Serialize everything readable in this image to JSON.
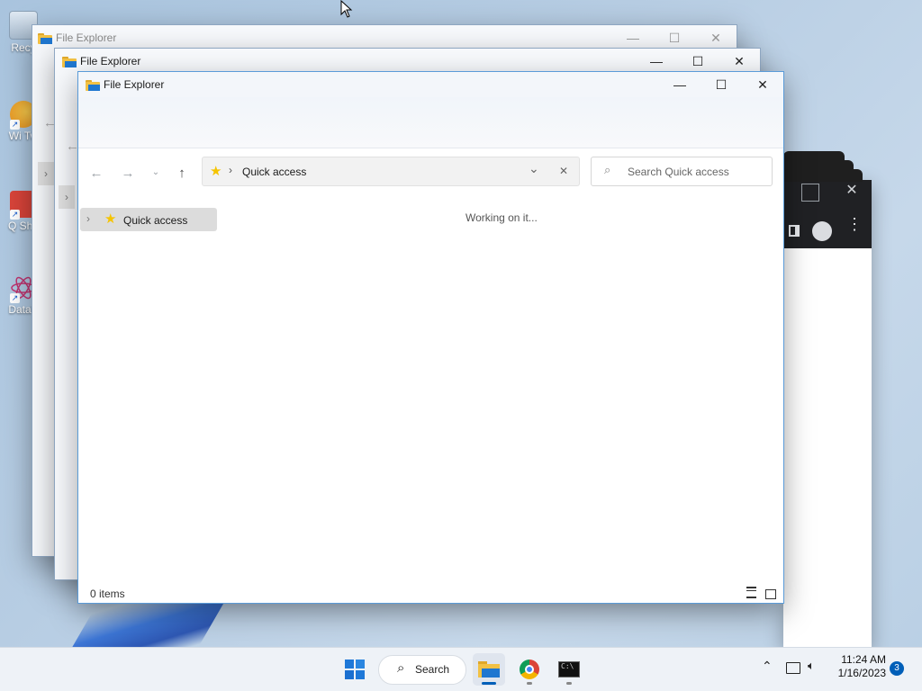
{
  "desktop": {
    "icons": [
      {
        "label": "Recy"
      },
      {
        "label": "Wi Tw"
      },
      {
        "label": "Q Shu"
      },
      {
        "label": "DataV"
      }
    ]
  },
  "windows": {
    "back1": {
      "title": "File Explorer"
    },
    "back2": {
      "title": "File Explorer"
    },
    "main": {
      "title": "File Explorer",
      "address": {
        "breadcrumb": "Quick access"
      },
      "search": {
        "placeholder": "Search Quick access"
      },
      "nav_pane": {
        "items": [
          {
            "label": "Quick access"
          }
        ]
      },
      "content": {
        "loading_text": "Working on it..."
      },
      "status": {
        "items_count": "0 items"
      }
    }
  },
  "taskbar": {
    "search_label": "Search",
    "clock": {
      "time": "11:24 AM",
      "date": "1/16/2023"
    },
    "notification_count": "3"
  },
  "colors": {
    "accent": "#005fb8",
    "folder_yellow": "#f2c144",
    "star_yellow": "#f5c400",
    "chrome_dark": "#202124"
  }
}
